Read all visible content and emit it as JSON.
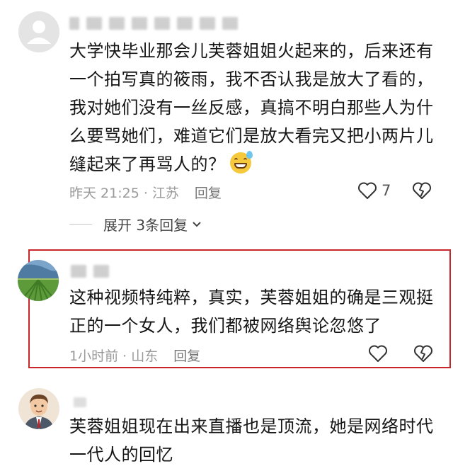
{
  "comments": [
    {
      "text_lines": [
        "大学快毕业那会儿芙蓉姐姐火起来的，后来还有",
        "一个拍写真的筱雨，我不否认我是放大了看的，",
        "我对她们没有一丝反感，真搞不明白那些人为什",
        "么要骂她们，难道它们是放大看完又把小两片儿",
        "缝起来了再骂人的？"
      ],
      "time_location": "昨天 21:25 · 江苏",
      "reply_label": "回复",
      "like_count": "7",
      "expand_label": "展开 3条回复"
    },
    {
      "text_lines": [
        "这种视频特纯粹，真实，芙蓉姐姐的确是三观挺",
        "正的一个女人，我们都被网络舆论忽悠了"
      ],
      "time_location": "1小时前 · 山东",
      "reply_label": "回复"
    },
    {
      "text_lines": [
        "芙蓉姐姐现在出来直播也是顶流，她是网络时代",
        "一代人的回忆"
      ]
    }
  ],
  "icons": {
    "like": "heart-outline-icon",
    "dislike": "broken-heart-icon",
    "expand": "chevron-down-icon",
    "emoji": "grinning-sweat-emoji"
  },
  "colors": {
    "highlight_border": "#c8262a",
    "meta_text": "#9a9a9a"
  }
}
